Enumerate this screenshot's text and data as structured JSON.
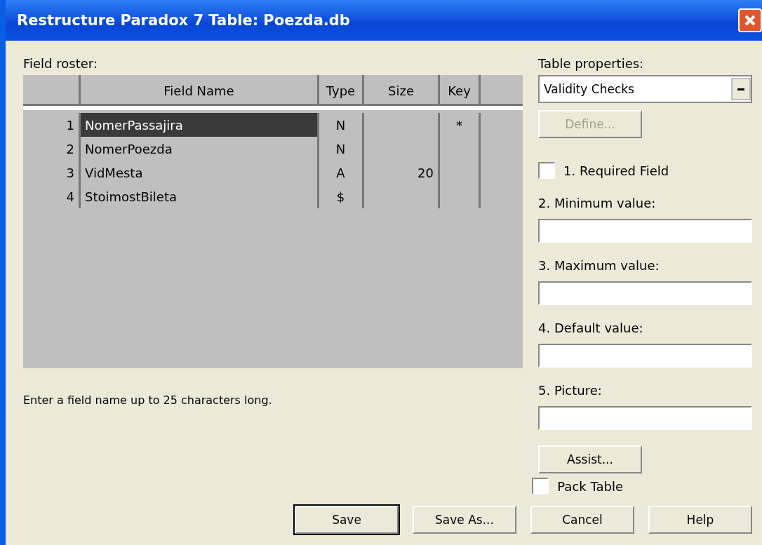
{
  "window": {
    "title": "Restructure Paradox 7 Table: Poezda.db"
  },
  "roster": {
    "label": "Field roster:",
    "columns": [
      "Field Name",
      "Type",
      "Size",
      "Key"
    ],
    "rows": [
      {
        "number": "1",
        "name": "NomerPassajira",
        "type": "N",
        "size": "",
        "key": "*",
        "selected": true
      },
      {
        "number": "2",
        "name": "NomerPoezda",
        "type": "N",
        "size": "",
        "key": "",
        "selected": false
      },
      {
        "number": "3",
        "name": "VidMesta",
        "type": "A",
        "size": "20",
        "key": "",
        "selected": false
      },
      {
        "number": "4",
        "name": "StoimostBileta",
        "type": "$",
        "size": "",
        "key": "",
        "selected": false
      }
    ]
  },
  "hint": "Enter a field name up to 25 characters long.",
  "properties": {
    "label": "Table properties:",
    "dropdown": "Validity Checks",
    "define_button": {
      "label": "Define...",
      "disabled": true
    },
    "required": {
      "label": "1. Required Field",
      "checked": false
    },
    "fields": [
      {
        "label": "2. Minimum value:"
      },
      {
        "label": "3. Maximum value:"
      },
      {
        "label": "4. Default value:"
      },
      {
        "label": "5. Picture:"
      }
    ],
    "assist_button": "Assist..."
  },
  "pack_table": {
    "label": "Pack Table",
    "checked": false
  },
  "buttons": [
    {
      "label": "Save",
      "default": true
    },
    {
      "label": "Save As...",
      "default": false
    },
    {
      "label": "Cancel",
      "default": false
    },
    {
      "label": "Help",
      "default": false
    }
  ]
}
